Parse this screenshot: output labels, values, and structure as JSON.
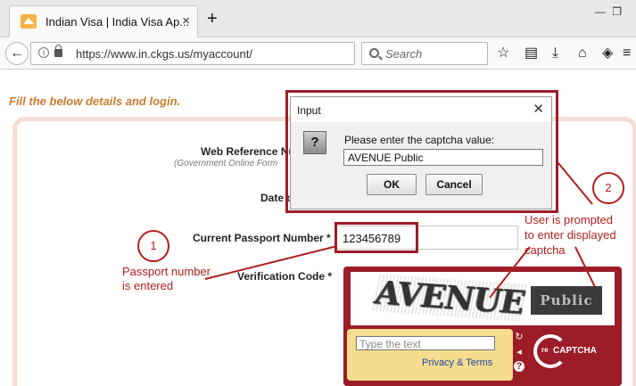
{
  "browser": {
    "tab_title": "Indian Visa | India Visa Ap...",
    "tab_close": "×",
    "new_tab": "+",
    "url": "https://www.in.ckgs.us/myaccount/",
    "search_placeholder": "Search"
  },
  "page": {
    "instruction": "Fill the below details and login.",
    "web_ref_label": "Web Reference Nu",
    "web_ref_sub": "(Government Online Form",
    "date_label": "Date o",
    "passport_label": "Current Passport Number *",
    "passport_value": "123456789",
    "verification_label": "Verification Code *"
  },
  "recaptcha": {
    "word1": "AVENUE",
    "word2": "Public",
    "input_placeholder": "Type the text",
    "privacy": "Privacy & Terms",
    "logo_re": "re",
    "logo_text": "CAPTCHA"
  },
  "dialog": {
    "title": "Input",
    "close": "✕",
    "prompt": "Please enter the captcha value:",
    "value": "AVENUE Public",
    "ok_label": "OK",
    "cancel_label": "Cancel"
  },
  "annotations": {
    "step1": "1",
    "step1_text_line1": "Passport number",
    "step1_text_line2": "is entered",
    "step2": "2",
    "step2_text_line1": "User is prompted",
    "step2_text_line2": "to enter displayed",
    "step2_text_line3": "captcha"
  },
  "colors": {
    "annotation_red": "#b01e1e",
    "recaptcha_red": "#9c1c28",
    "instruction_orange": "#c97a2e"
  }
}
